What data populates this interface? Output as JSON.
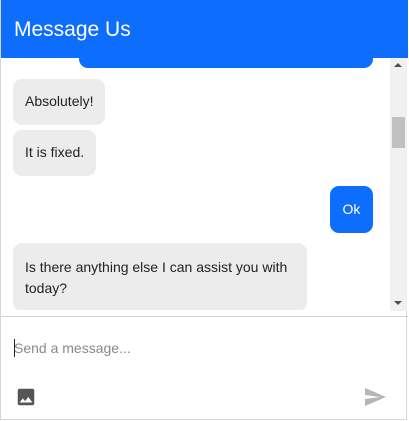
{
  "header": {
    "title": "Message Us"
  },
  "messages": [
    {
      "sender": "agent",
      "text": "Absolutely!"
    },
    {
      "sender": "agent",
      "text": "It is fixed."
    },
    {
      "sender": "user",
      "text": "Ok"
    },
    {
      "sender": "agent",
      "text": "Is there anything else I can assist you with today?"
    }
  ],
  "composer": {
    "placeholder": "Send a message...",
    "value": ""
  },
  "icons": {
    "attach": "image-icon",
    "send": "send-icon"
  },
  "colors": {
    "accent": "#0d6efd",
    "incoming_bubble": "#ececec",
    "send_icon": "#b5b5b5",
    "image_icon": "#555555"
  }
}
